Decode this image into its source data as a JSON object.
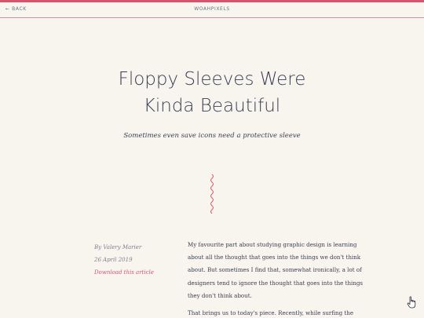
{
  "header": {
    "back_label": "← BACK",
    "site_name": "WOAHPIXELS"
  },
  "article": {
    "title_line1": "Floppy Sleeves Were",
    "title_line2": "Kinda Beautiful",
    "subtitle": "Sometimes even save icons need a protective sleeve",
    "author": "By Valery Marier",
    "date": "26 April 2019",
    "download_label": "Download this article",
    "paragraph1": "My favourite part about studying graphic design is learning about all the thought that goes into the things we don't think about. But sometimes I find that, somewhat ironically, a lot of designers tend to ignore the thought that goes into the things they don't think about.",
    "paragraph2": "That brings us to today's piece. Recently, while surfing the"
  },
  "colors": {
    "accent": "#d8546c",
    "text": "#3a3d55",
    "muted": "#7d7f92",
    "background": "#f8f5ef"
  },
  "icons": {
    "divider": "squiggle-divider",
    "cursor": "hand-pointer-icon"
  }
}
